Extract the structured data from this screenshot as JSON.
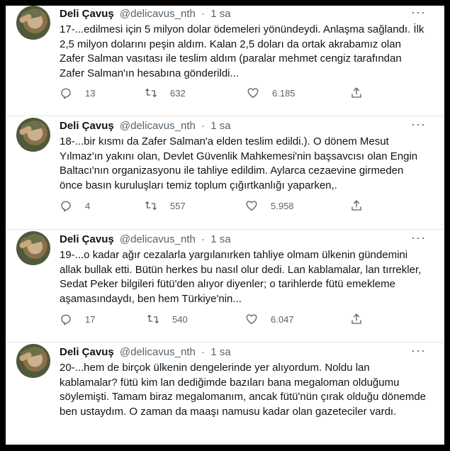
{
  "tweets": [
    {
      "name": "Deli Çavuş",
      "handle": "@delicavus_nth",
      "separator": "·",
      "time": "1 sa",
      "text": "17-...edilmesi için 5 milyon dolar ödemeleri yönündeydi. Anlaşma sağlandı. İlk 2,5 milyon dolarını peşin aldım. Kalan 2,5 doları da ortak akrabamız olan Zafer Salman vasıtası ile teslim aldım (paralar mehmet cengiz tarafından Zafer Salman'ın hesabına gönderildi...",
      "replies": "13",
      "retweets": "632",
      "likes": "6.185"
    },
    {
      "name": "Deli Çavuş",
      "handle": "@delicavus_nth",
      "separator": "·",
      "time": "1 sa",
      "text": "18-...bir kısmı da Zafer Salman'a elden teslim edildi.). O dönem Mesut Yılmaz'ın yakını olan, Devlet Güvenlik Mahkemesi'nin başsavcısı olan Engin Baltacı'nın organizasyonu ile tahliye edildim. Aylarca cezaevine girmeden önce basın kuruluşları temiz toplum çığırtkanlığı yaparken,.",
      "replies": "4",
      "retweets": "557",
      "likes": "5.958"
    },
    {
      "name": "Deli Çavuş",
      "handle": "@delicavus_nth",
      "separator": "·",
      "time": "1 sa",
      "text": "19-...o kadar ağır cezalarla yargılanırken tahliye olmam ülkenin gündemini allak bullak etti. Bütün herkes bu nasıl olur dedi. Lan kablamalar, lan tırrekler, Sedat Peker bilgileri fütü'den alıyor diyenler; o tarihlerde fütü emekleme aşamasındaydı, ben hem Türkiye'nin...",
      "replies": "17",
      "retweets": "540",
      "likes": "6.047"
    },
    {
      "name": "Deli Çavuş",
      "handle": "@delicavus_nth",
      "separator": "·",
      "time": "1 sa",
      "text": "20-...hem de birçok ülkenin dengelerinde yer alıyordum. Noldu lan kablamalar? fütü kim lan dediğimde bazıları bana megaloman olduğumu söylemişti. Tamam biraz megalomanım, ancak fütü'nün çırak olduğu dönemde ben ustaydım. O zaman da maaşı namusu kadar olan gazeteciler vardı.",
      "replies": "",
      "retweets": "",
      "likes": ""
    }
  ],
  "icons": {
    "reply": "reply-icon",
    "retweet": "retweet-icon",
    "like": "heart-icon",
    "share": "share-icon",
    "more": "more-icon",
    "avatar": "avatar"
  },
  "colors": {
    "name": "#0f1419",
    "secondary": "#536471",
    "frame": "#000000"
  }
}
